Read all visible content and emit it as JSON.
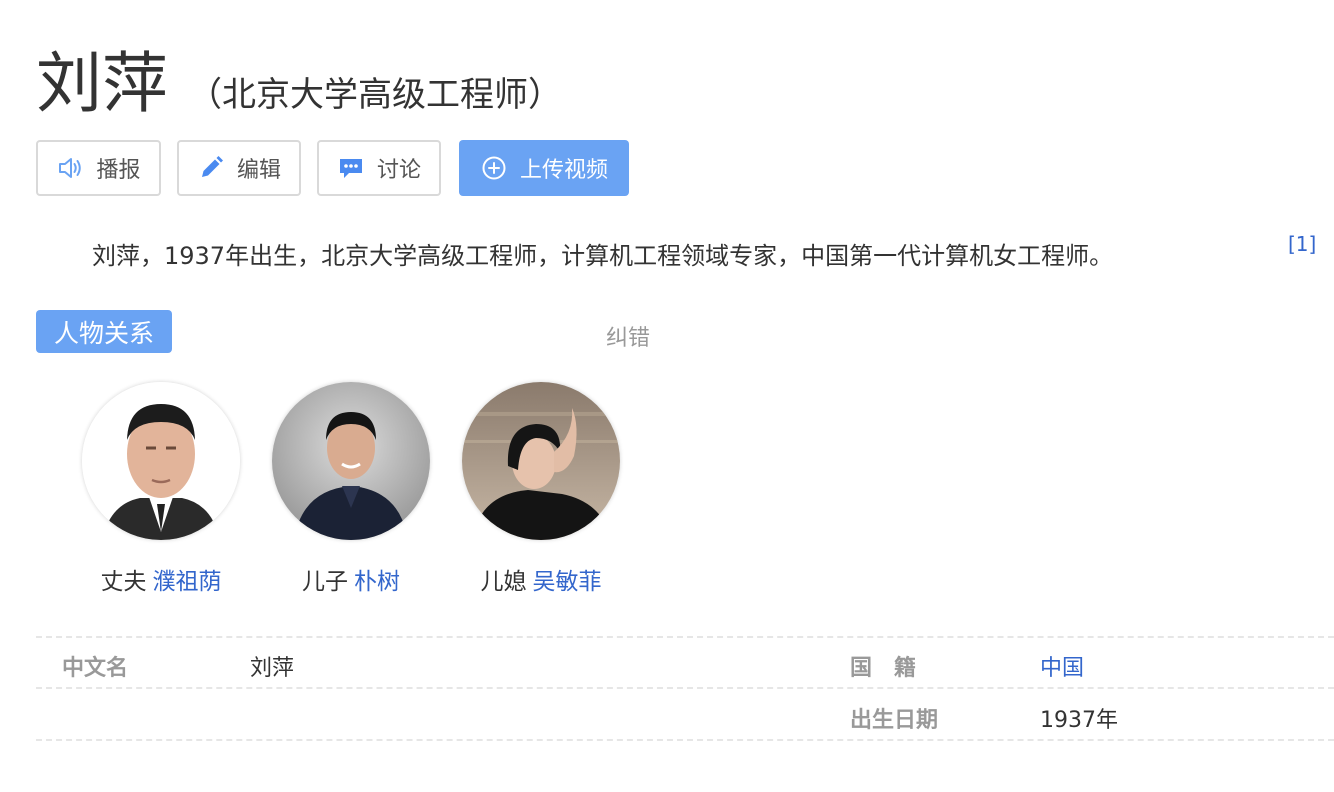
{
  "title": {
    "name": "刘萍",
    "subtitle": "（北京大学高级工程师）"
  },
  "toolbar": {
    "broadcast_label": "播报",
    "edit_label": "编辑",
    "discuss_label": "讨论",
    "upload_label": "上传视频"
  },
  "summary": {
    "text": "刘萍，1937年出生，北京大学高级工程师，计算机工程领域专家，中国第一代计算机女工程师。",
    "citation": "[1]"
  },
  "relations": {
    "heading": "人物关系",
    "correct_label": "纠错",
    "people": [
      {
        "relation": "丈夫",
        "name": "濮祖荫"
      },
      {
        "relation": "儿子",
        "name": "朴树"
      },
      {
        "relation": "儿媳",
        "name": "吴敏菲"
      }
    ]
  },
  "info": {
    "chinese_name_label": "中文名",
    "chinese_name_value": "刘萍",
    "nationality_label": "国　籍",
    "nationality_value": "中国",
    "birth_label": "出生日期",
    "birth_value": "1937年"
  },
  "colors": {
    "accent": "#6aa3f3",
    "link": "#3366cc",
    "label_gray": "#999999"
  }
}
